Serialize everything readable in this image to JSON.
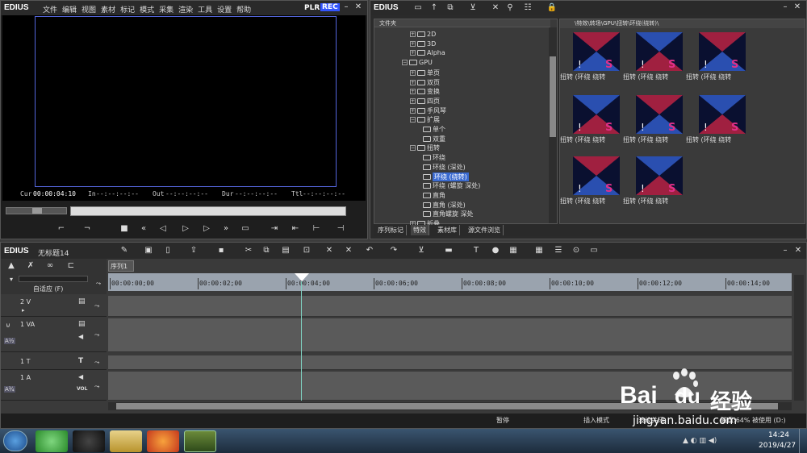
{
  "player": {
    "logo": "EDIUS",
    "menu": [
      "文件",
      "编辑",
      "视图",
      "素材",
      "标记",
      "模式",
      "采集",
      "渲染",
      "工具",
      "设置",
      "帮助"
    ],
    "plr": "PLR",
    "rec": "REC",
    "timecodes": {
      "cur_label": "Cur",
      "cur_value": "00:00:04:10",
      "in_label": "In",
      "in_value": "--:--:--:--",
      "out_label": "Out",
      "out_value": "--:--:--:--",
      "dur_label": "Dur",
      "dur_value": "--:--:--:--",
      "ttl_label": "Ttl",
      "ttl_value": "--:--:--:--"
    }
  },
  "bin": {
    "logo": "EDIUS",
    "folder_header": "文件夹",
    "tree": [
      {
        "label": "2D",
        "indent": 2,
        "type": "leaf"
      },
      {
        "label": "3D",
        "indent": 2,
        "type": "leaf"
      },
      {
        "label": "Alpha",
        "indent": 2,
        "type": "leaf"
      },
      {
        "label": "GPU",
        "indent": 1,
        "type": "open"
      },
      {
        "label": "单页",
        "indent": 2,
        "type": "leaf"
      },
      {
        "label": "双页",
        "indent": 2,
        "type": "leaf"
      },
      {
        "label": "变换",
        "indent": 2,
        "type": "leaf"
      },
      {
        "label": "四页",
        "indent": 2,
        "type": "leaf"
      },
      {
        "label": "手风琴",
        "indent": 2,
        "type": "leaf"
      },
      {
        "label": "扩展",
        "indent": 2,
        "type": "open"
      },
      {
        "label": "单个",
        "indent": 3,
        "type": "leaf"
      },
      {
        "label": "双重",
        "indent": 3,
        "type": "leaf"
      },
      {
        "label": "扭转",
        "indent": 2,
        "type": "open"
      },
      {
        "label": "环绕",
        "indent": 3,
        "type": "leaf"
      },
      {
        "label": "环绕 (深处)",
        "indent": 3,
        "type": "leaf"
      },
      {
        "label": "环绕 (绕转)",
        "indent": 3,
        "type": "selected"
      },
      {
        "label": "环绕 (螺旋 深处)",
        "indent": 3,
        "type": "leaf"
      },
      {
        "label": "直角",
        "indent": 3,
        "type": "leaf"
      },
      {
        "label": "直角 (深处)",
        "indent": 3,
        "type": "leaf"
      },
      {
        "label": "直角螺旋 深处",
        "indent": 3,
        "type": "leaf"
      },
      {
        "label": "折叠",
        "indent": 2,
        "type": "leaf"
      }
    ],
    "path": "\\特效\\转场\\GPU\\扭转\\环绕(绕转)\\",
    "thumbs": [
      {
        "caption": "扭转 (环绕 绕转"
      },
      {
        "caption": "扭转 (环绕 绕转"
      },
      {
        "caption": "扭转 (环绕 绕转"
      },
      {
        "caption": "扭转 (环绕 绕转"
      },
      {
        "caption": "扭转 (环绕 绕转"
      },
      {
        "caption": "扭转 (环绕 绕转"
      },
      {
        "caption": "扭转 (环绕 绕转"
      },
      {
        "caption": "扭转 (环绕 绕转"
      }
    ],
    "tabs": [
      "序列标记",
      "特效",
      "素材库",
      "源文件浏览"
    ]
  },
  "timeline": {
    "logo": "EDIUS",
    "project_name": "无标题14",
    "sequence_tab": "序列1",
    "auto_label": "自适应 (F)",
    "ruler": [
      "00:00:00;00",
      "00:00:02;00",
      "00:00:04;00",
      "00:00:06;00",
      "00:00:08;00",
      "00:00:10;00",
      "00:00:12;00",
      "00:00:14;00"
    ],
    "tracks": [
      {
        "name": "2 V"
      },
      {
        "name": "1 VA"
      },
      {
        "name": "1 T"
      },
      {
        "name": "1 A"
      }
    ],
    "vol_label": "VOL",
    "status": [
      "暂停",
      "插入模式",
      "波纹关闭",
      "磁盘:64% 被使用 (D:)"
    ]
  },
  "taskbar": {
    "time": "14:24",
    "date": "2019/4/27"
  },
  "watermark": {
    "brand": "Bai",
    "brand2": "du",
    "jingyan": "经验",
    "url": "jingyan.baidu.com"
  },
  "colors": {
    "rec_blue": "#3355ff",
    "selected": "#3a6ad0",
    "playhead": "#7fd0c0"
  }
}
